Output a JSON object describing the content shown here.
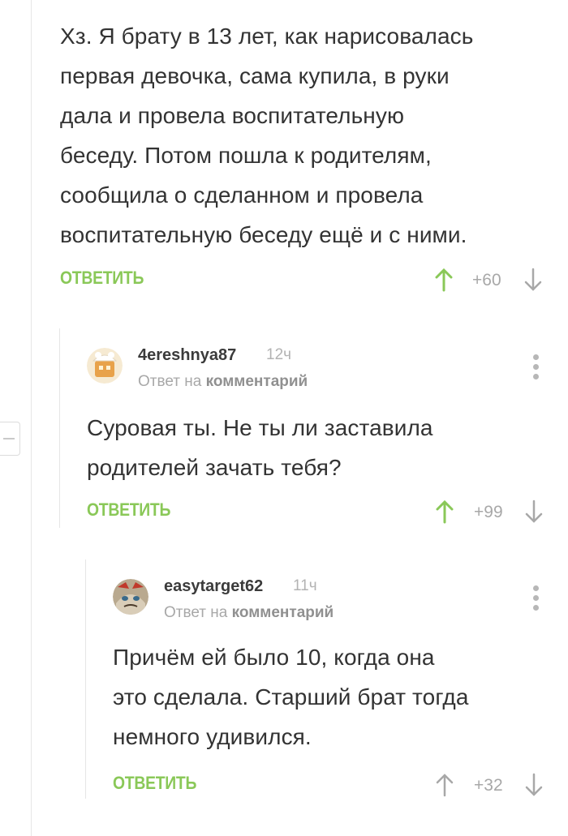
{
  "comments": [
    {
      "text": "Хз. Я брату в 13 лет, как нарисовалась\nпервая девочка, сама купила, в руки\nдала и провела воспитательную\nбеседу. Потом пошла к родителям,\nсообщила о сделанном и провела\nвоспитательную беседу ещё и с ними.",
      "reply_label": "ОТВЕТИТЬ",
      "score": "+60"
    },
    {
      "username": "4ereshnya87",
      "time": "12ч",
      "reply_to_prefix": "Ответ на",
      "reply_to_target": "комментарий",
      "text": "Суровая ты. Не ты ли заставила\nродителей зачать тебя?",
      "reply_label": "ОТВЕТИТЬ",
      "score": "+99"
    },
    {
      "username": "easytarget62",
      "time": "11ч",
      "reply_to_prefix": "Ответ на",
      "reply_to_target": "комментарий",
      "text": "Причём ей было 10, когда она\nэто сделала. Старший брат тогда\nнемного удивился.",
      "reply_label": "ОТВЕТИТЬ",
      "score": "+32"
    }
  ],
  "colors": {
    "accent": "#8ac858",
    "text": "#333333",
    "muted": "#a8a8a8"
  },
  "icons": {
    "vote_up": "arrow-up-icon",
    "vote_down": "arrow-down-icon",
    "more": "more-vertical-icon",
    "collapse": "minus-icon"
  }
}
